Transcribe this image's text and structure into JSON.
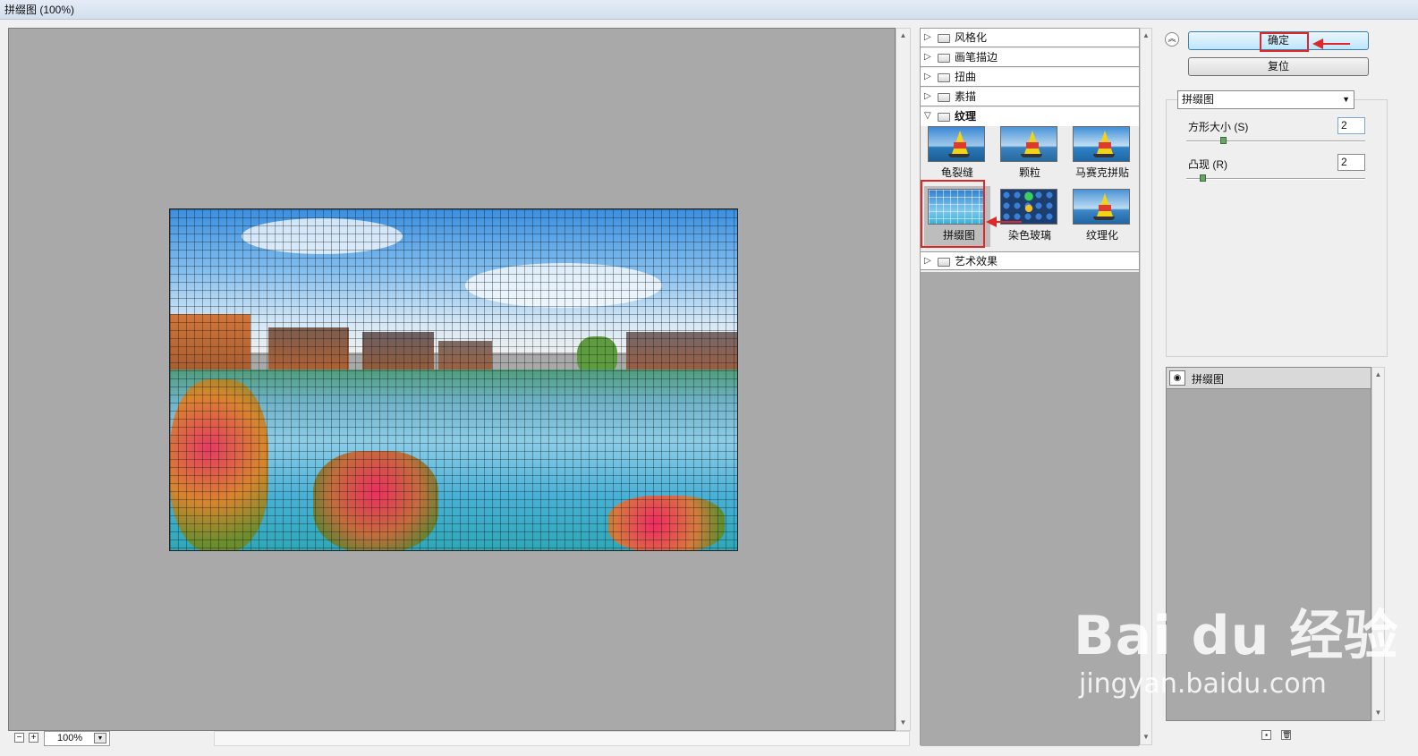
{
  "window": {
    "title": "拼缀图 (100%)"
  },
  "preview": {
    "zoom_value": "100%"
  },
  "gallery": {
    "categories_top": [
      "风格化",
      "画笔描边",
      "扭曲",
      "素描"
    ],
    "open_category": "纹理",
    "thumbnails": [
      "龟裂缝",
      "颗粒",
      "马赛克拼贴",
      "拼缀图",
      "染色玻璃",
      "纹理化"
    ],
    "selected_thumbnail": "拼缀图",
    "categories_bottom": [
      "艺术效果"
    ]
  },
  "buttons": {
    "ok_label": "确定",
    "reset_label": "复位"
  },
  "settings": {
    "filter_selected": "拼缀图",
    "params": [
      {
        "label": "方形大小 (S)",
        "value": "2",
        "level": 0.2
      },
      {
        "label": "凸现 (R)",
        "value": "2",
        "level": 0.08
      }
    ]
  },
  "layers": {
    "items": [
      "拼缀图"
    ]
  },
  "watermark": {
    "logo": "Bai du 经验",
    "sub": "jingyan.baidu.com"
  },
  "colors": {
    "annotation_red": "#e02727",
    "preview_bg": "#a9a9a9",
    "default_button": "#bee6fd"
  },
  "icons": {
    "expand": "triangle-right-icon",
    "collapse": "triangle-down-icon",
    "folder": "folder-icon",
    "eye": "eye-icon"
  }
}
